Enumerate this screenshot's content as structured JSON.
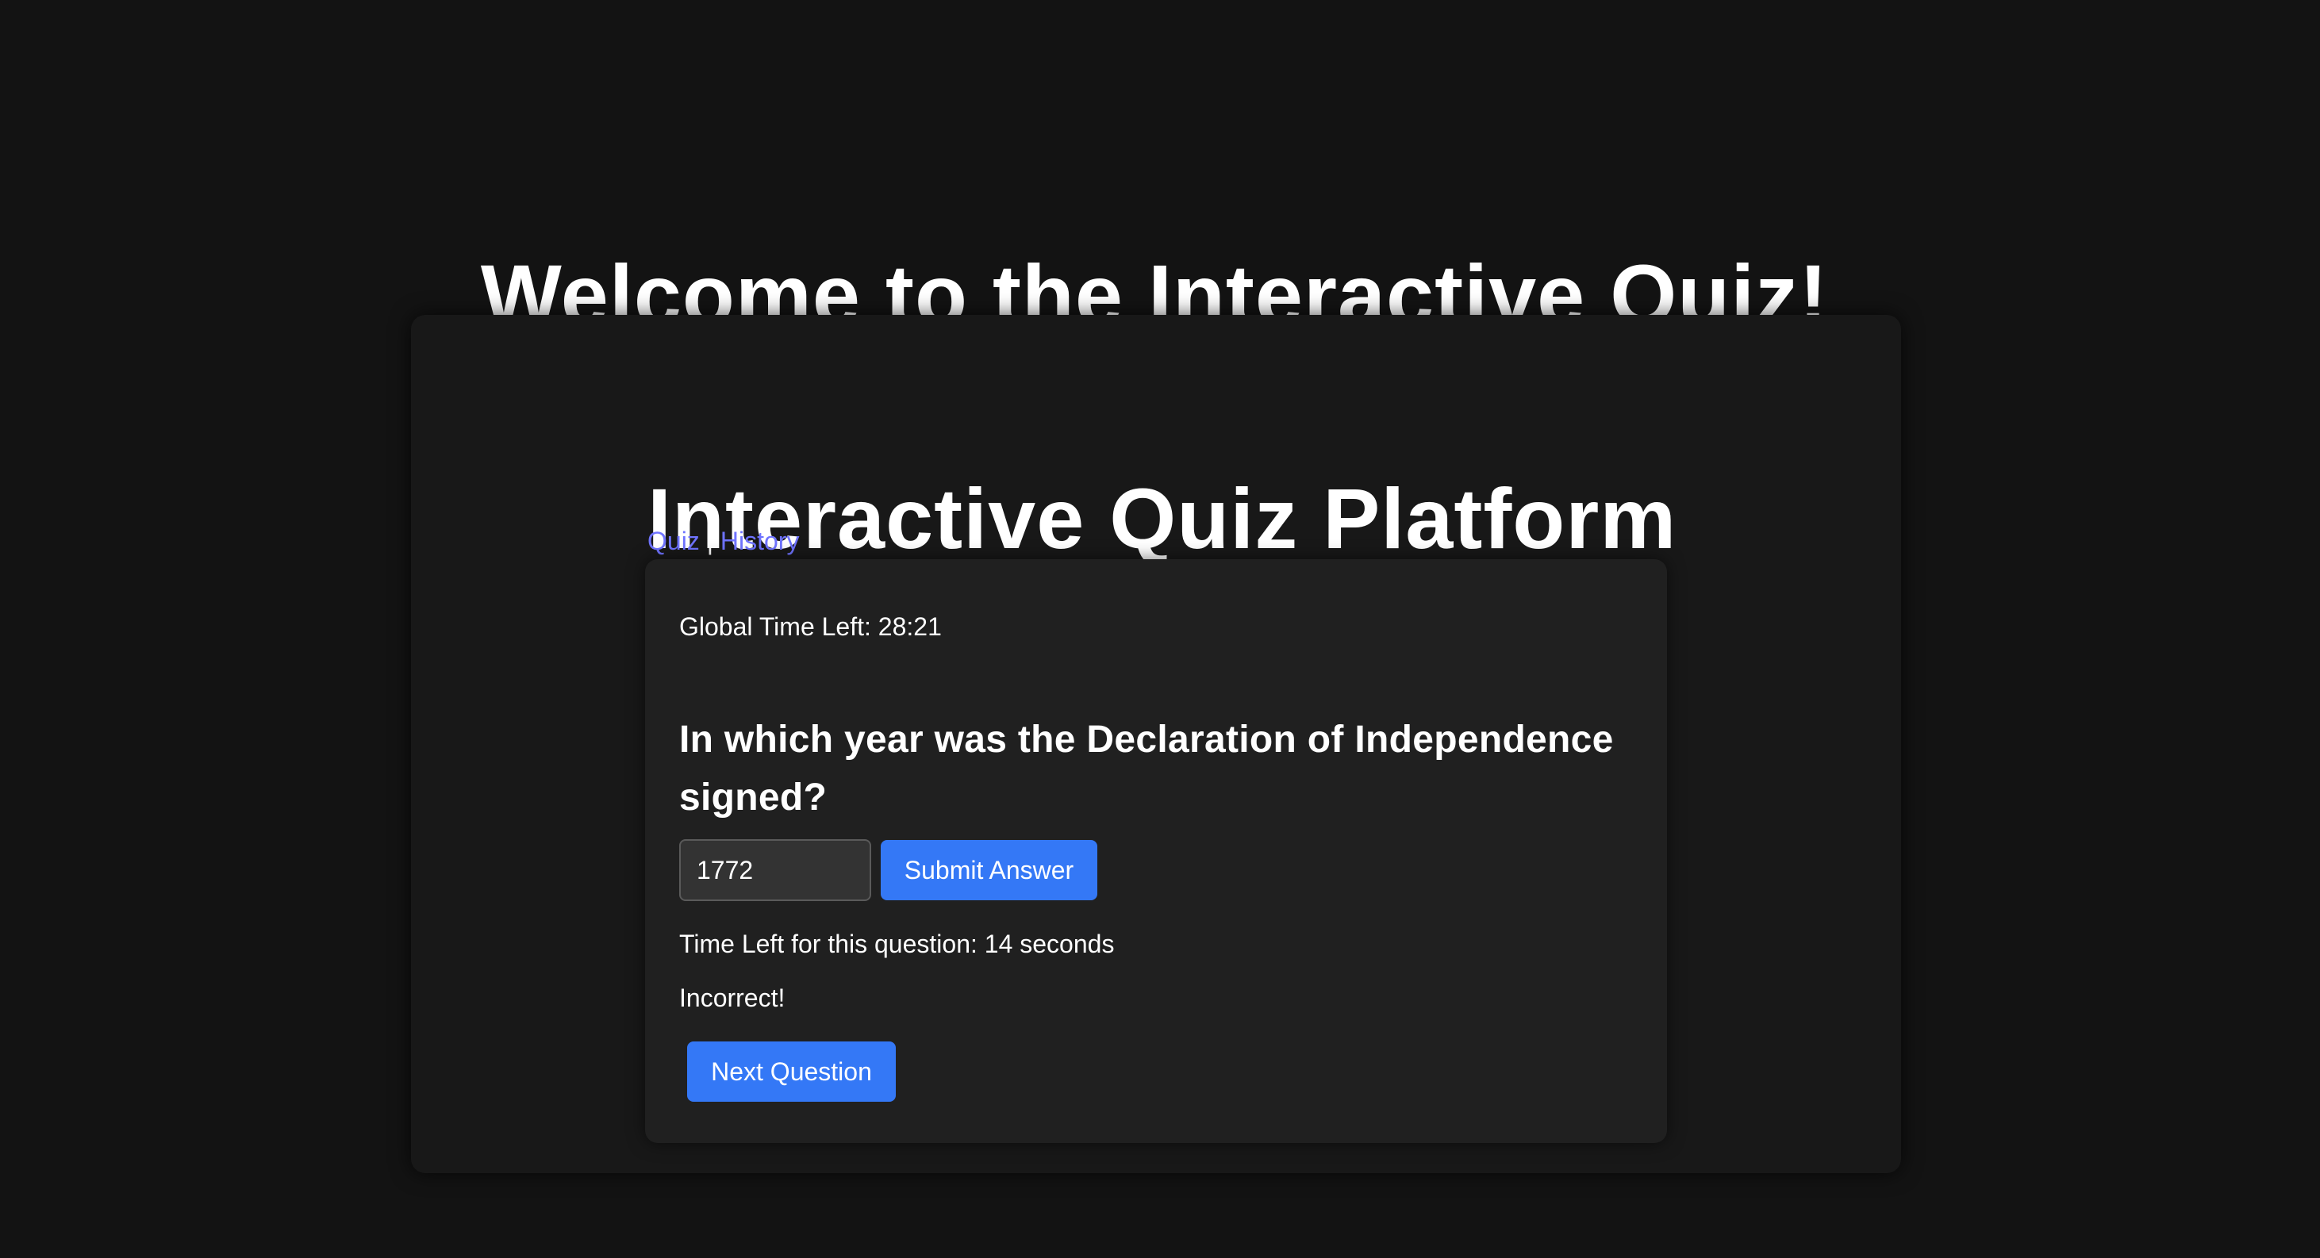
{
  "page": {
    "heading": "Welcome to the Interactive Quiz!"
  },
  "app": {
    "title": "Interactive Quiz Platform",
    "nav": {
      "quiz_label": "Quiz",
      "separator": "|",
      "history_label": "History"
    }
  },
  "quiz": {
    "global_time_label": "Global Time Left: 28:21",
    "question": "In which year was the Declaration of Independence signed?",
    "answer_value": "1772",
    "submit_label": "Submit Answer",
    "question_time_label": "Time Left for this question: 14 seconds",
    "feedback": "Incorrect!",
    "next_label": "Next Question"
  },
  "colors": {
    "background": "#131313",
    "card": "#181818",
    "inner_card": "#202020",
    "link": "#6f73ff",
    "button": "#3478f6"
  }
}
